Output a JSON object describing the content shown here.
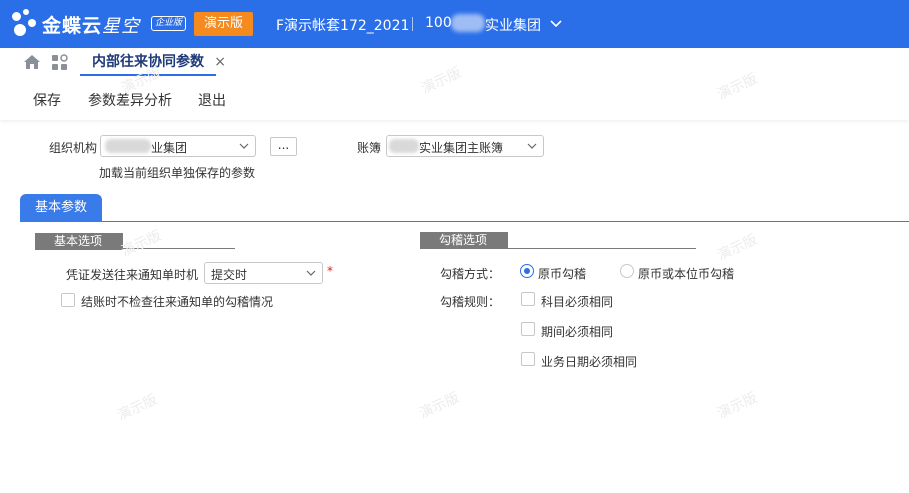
{
  "header": {
    "brand": "金蝶云",
    "brand_sub": "星空",
    "edition_badge": "企业版",
    "demo_badge": "演示版",
    "account_set": "F演示帐套172_2021",
    "org_code": "100",
    "org_name_tail": "实业集团",
    "chevron_icon": "chevron-down-icon",
    "bar_color": "#2a6ee8",
    "demo_color": "#f58a1f"
  },
  "tabs": {
    "home_icon": "home-icon",
    "apps_icon": "apps-grid-icon",
    "active_tab": "内部往来协同参数",
    "close": "×"
  },
  "toolbar": {
    "save": "保存",
    "diff_analysis": "参数差异分析",
    "exit": "退出"
  },
  "filter": {
    "org_label": "组织机构",
    "org_value_tail": "业集团",
    "ellipsis": "...",
    "book_label": "账簿",
    "book_value_tail": "实业集团主账簿",
    "load_hint": "加载当前组织单独保存的参数"
  },
  "section": {
    "tab": "基本参数",
    "accent": "#3a7bea"
  },
  "basic": {
    "title": "基本选项",
    "timing_label": "凭证发送往来通知单时机",
    "timing_value": "提交时",
    "required_mark": "*",
    "skip_check_label": "结账时不检查往来通知单的勾稽情况",
    "skip_check_checked": false
  },
  "match": {
    "title": "勾稽选项",
    "mode_label": "勾稽方式：",
    "mode_options": [
      "原币勾稽",
      "原币或本位币勾稽"
    ],
    "mode_selected": "原币勾稽",
    "rule_label": "勾稽规则：",
    "rules": [
      {
        "label": "科目必须相同",
        "checked": false
      },
      {
        "label": "期间必须相同",
        "checked": false
      },
      {
        "label": "业务日期必须相同",
        "checked": false
      }
    ]
  },
  "watermark": "演示版"
}
